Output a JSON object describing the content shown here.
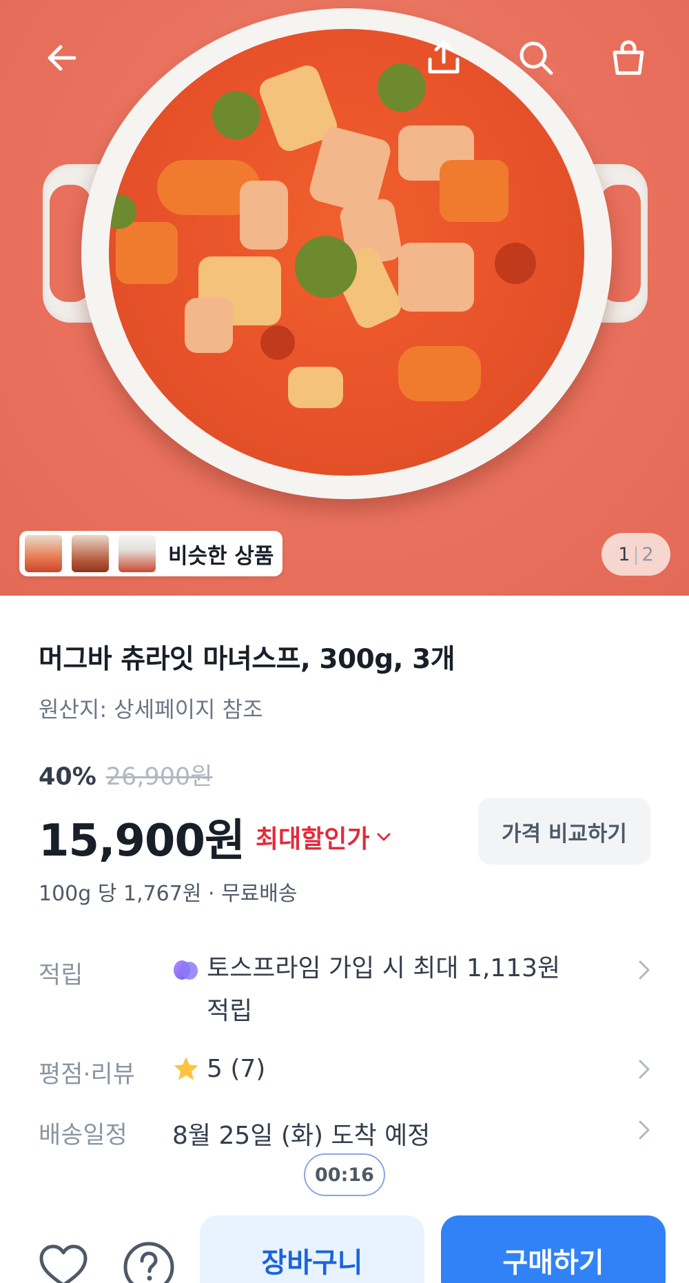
{
  "header": {
    "back_icon": "arrow-left-icon",
    "share_icon": "share-icon",
    "search_icon": "search-icon",
    "cart_icon": "shopping-bag-icon"
  },
  "gallery": {
    "similar_label": "비슷한 상품",
    "page_current": "1",
    "page_separator": "|",
    "page_total": "2"
  },
  "product": {
    "title": "머그바 츄라잇 마녀스프, 300g, 3개",
    "origin": "원산지: 상세페이지 참조",
    "discount": "40%",
    "original_price": "26,900원",
    "price": "15,900원",
    "max_discount_label": "최대할인가",
    "compare_label": "가격 비교하기",
    "unit_price": "100g 당 1,767원 · 무료배송"
  },
  "info": {
    "points_label": "적립",
    "points_value": "토스프라임 가입 시 최대 1,113원 적립",
    "rating_label": "평점·리뷰",
    "rating_value": "5 (7)",
    "delivery_label": "배송일정",
    "delivery_value": "8월 25일 (화) 도착 예정"
  },
  "timer": "00:16",
  "bottom": {
    "cart_label": "장바구니",
    "buy_label": "구매하기"
  },
  "colors": {
    "primary": "#3182f6",
    "cart_bg": "#e8f3ff",
    "discount_red": "#e42939",
    "hero_bg": "#ea7460",
    "star": "#ffc342"
  }
}
